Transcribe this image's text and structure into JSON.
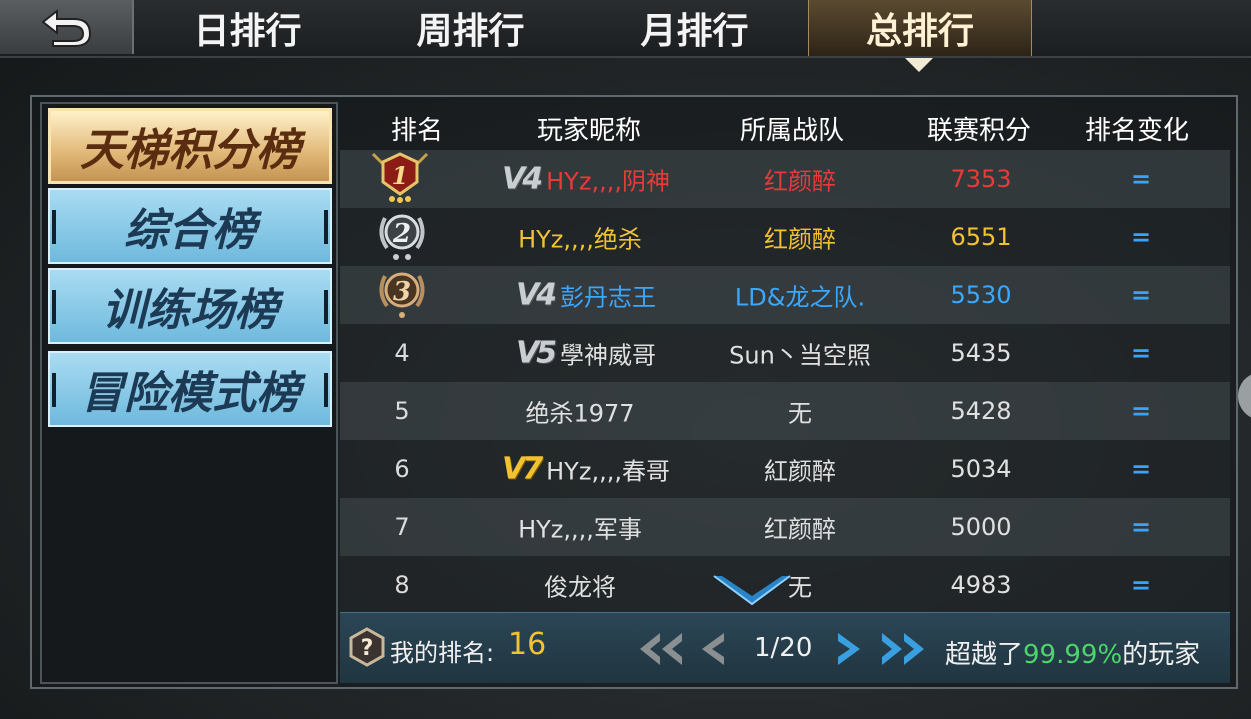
{
  "tabs": [
    {
      "label": "日排行",
      "active": false
    },
    {
      "label": "周排行",
      "active": false
    },
    {
      "label": "月排行",
      "active": false
    },
    {
      "label": "总排行",
      "active": true
    }
  ],
  "sidebar": {
    "items": [
      {
        "label": "天梯积分榜",
        "active": true
      },
      {
        "label": "综合榜",
        "active": false
      },
      {
        "label": "训练场榜",
        "active": false
      },
      {
        "label": "冒险模式榜",
        "active": false
      }
    ]
  },
  "table": {
    "headers": [
      "排名",
      "玩家昵称",
      "所属战队",
      "联赛积分",
      "排名变化"
    ],
    "rows": [
      {
        "rank": "1",
        "medal": "gold",
        "vip": "V4",
        "name": "HYz,,,,阴神",
        "team": "红颜醉",
        "score": "7353",
        "change": "=",
        "color": "red"
      },
      {
        "rank": "2",
        "medal": "silver",
        "vip": "",
        "name": "HYz,,,,绝杀",
        "team": "红颜醉",
        "score": "6551",
        "change": "=",
        "color": "gold"
      },
      {
        "rank": "3",
        "medal": "bronze",
        "vip": "V4",
        "name": "彭丹志王",
        "team": "LD&龙之队.",
        "score": "5530",
        "change": "=",
        "color": "blue"
      },
      {
        "rank": "4",
        "medal": "",
        "vip": "V5",
        "name": "學神威哥",
        "team": "Sun丶当空照",
        "score": "5435",
        "change": "=",
        "color": "white"
      },
      {
        "rank": "5",
        "medal": "",
        "vip": "",
        "name": "绝杀1977",
        "team": "无",
        "score": "5428",
        "change": "=",
        "color": "white"
      },
      {
        "rank": "6",
        "medal": "",
        "vip": "V7",
        "name": "HYz,,,,春哥",
        "team": "紅颜醉",
        "score": "5034",
        "change": "=",
        "color": "white"
      },
      {
        "rank": "7",
        "medal": "",
        "vip": "",
        "name": "HYz,,,,军事",
        "team": "红颜醉",
        "score": "5000",
        "change": "=",
        "color": "white"
      },
      {
        "rank": "8",
        "medal": "",
        "vip": "",
        "name": "俊龙将",
        "team": "无",
        "score": "4983",
        "change": "=",
        "color": "white"
      }
    ]
  },
  "footer": {
    "my_rank_label": "我的排名:",
    "my_rank_value": "16",
    "page": "1/20",
    "surpass_prefix": "超越了",
    "surpass_percent": "99.99%",
    "surpass_suffix": "的玩家"
  },
  "icons": {
    "back": "back-arrow-icon",
    "help": "question-icon",
    "first": "double-chevron-left-icon",
    "prev": "chevron-left-icon",
    "next": "chevron-right-icon",
    "last": "double-chevron-right-icon"
  }
}
